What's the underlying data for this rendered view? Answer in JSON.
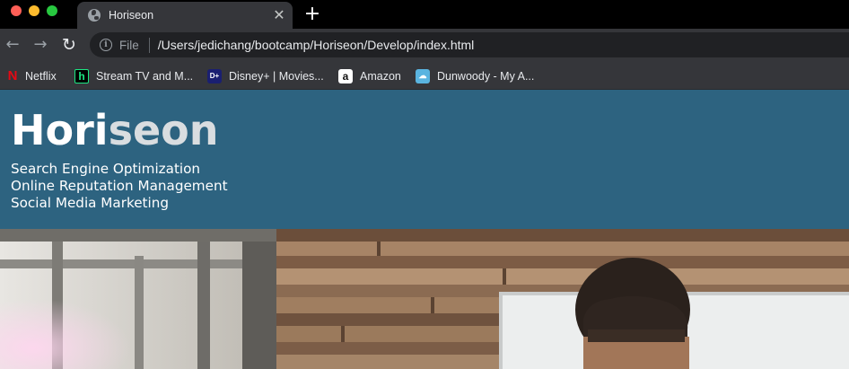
{
  "browser": {
    "tab": {
      "title": "Horiseon",
      "close_glyph": "✕"
    },
    "new_tab_glyph": "+",
    "address": {
      "scheme_label": "File",
      "url": "/Users/jedichang/bootcamp/Horiseon/Develop/index.html"
    },
    "bookmarks": [
      {
        "label": "Netflix",
        "icon": "netflix-icon"
      },
      {
        "label": "Stream TV and M...",
        "icon": "hulu-icon"
      },
      {
        "label": "Disney+ | Movies...",
        "icon": "disney-plus-icon"
      },
      {
        "label": "Amazon",
        "icon": "amazon-icon"
      },
      {
        "label": "Dunwoody - My A...",
        "icon": "dunwoody-icon"
      }
    ]
  },
  "page": {
    "brand": {
      "part1": "Hori",
      "part2": "seon"
    },
    "menu": [
      "Search Engine Optimization",
      "Online Reputation Management",
      "Social Media Marketing"
    ],
    "hero": {
      "image": "hero-photo-man-at-whiteboard"
    }
  },
  "colors": {
    "header_bg": "#2d6380",
    "brand_accent": "#d9dde0",
    "chrome_bg": "#35363a",
    "tabbar_bg": "#000000",
    "omnibox_bg": "#202124"
  }
}
